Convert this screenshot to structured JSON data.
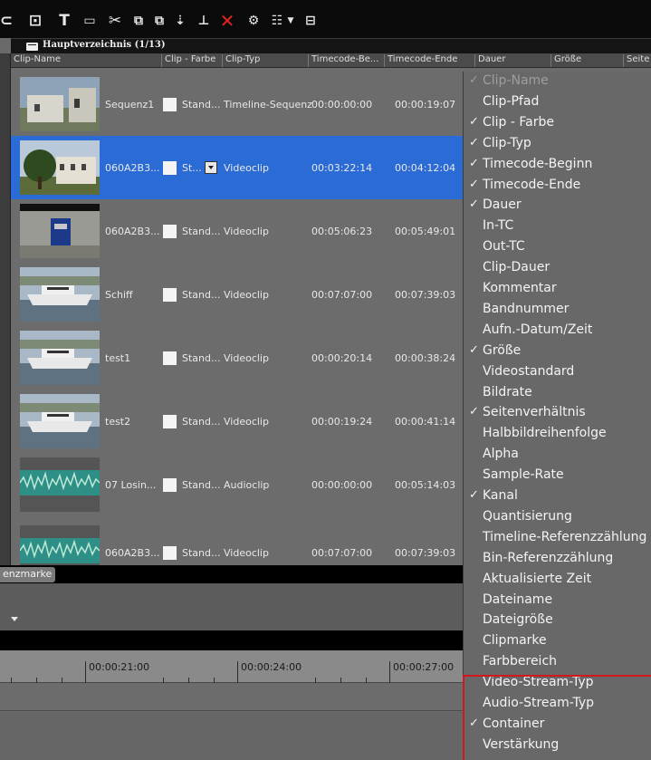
{
  "toolbar": {
    "icons": [
      "folder-in-icon",
      "title-icon",
      "monitor-icon",
      "cut-icon",
      "copy-icon",
      "paste-icon",
      "insert-icon",
      "overwrite-icon",
      "delete-icon",
      "properties-icon",
      "list-view-icon",
      "dropdown-icon",
      "storyboard-icon"
    ],
    "title_glyph": "T"
  },
  "bin": {
    "title": "Hauptverzeichnis (1/13)"
  },
  "columns": [
    "Clip-Name",
    "Clip - Farbe",
    "Clip-Typ",
    "Timecode-Be...",
    "Timecode-Ende",
    "Dauer",
    "Größe",
    "Seite"
  ],
  "clips": [
    {
      "name": "Sequenz1",
      "color": "Stand...",
      "type": "Timeline-Sequenz",
      "tc_begin": "00:00:00:00",
      "tc_end": "00:00:19:07",
      "thumb": "building"
    },
    {
      "name": "060A2B3...",
      "color": "St...",
      "type": "Videoclip",
      "tc_begin": "00:03:22:14",
      "tc_end": "00:04:12:04",
      "thumb": "tree-building",
      "selected": true
    },
    {
      "name": "060A2B3...",
      "color": "Stand...",
      "type": "Videoclip",
      "tc_begin": "00:05:06:23",
      "tc_end": "00:05:49:01",
      "thumb": "mailbox"
    },
    {
      "name": "Schiff",
      "color": "Stand...",
      "type": "Videoclip",
      "tc_begin": "00:07:07:00",
      "tc_end": "00:07:39:03",
      "thumb": "ship"
    },
    {
      "name": "test1",
      "color": "Stand...",
      "type": "Videoclip",
      "tc_begin": "00:00:20:14",
      "tc_end": "00:00:38:24",
      "thumb": "ship"
    },
    {
      "name": "test2",
      "color": "Stand...",
      "type": "Videoclip",
      "tc_begin": "00:00:19:24",
      "tc_end": "00:00:41:14",
      "thumb": "ship"
    },
    {
      "name": "07 Losin...",
      "color": "Stand...",
      "type": "Audioclip",
      "tc_begin": "00:00:00:00",
      "tc_end": "00:05:14:03",
      "thumb": "audio"
    },
    {
      "name": "060A2B3...",
      "color": "Stand...",
      "type": "Videoclip",
      "tc_begin": "00:07:07:00",
      "tc_end": "00:07:39:03",
      "thumb": "audio"
    }
  ],
  "bottom": {
    "tab_label": "enzmarke",
    "ruler_labels": [
      "00:00:21:00",
      "00:00:24:00",
      "00:00:27:00"
    ]
  },
  "menu": {
    "check_glyph": "✓",
    "items": [
      {
        "label": "Clip-Name",
        "checked": true,
        "disabled": true
      },
      {
        "label": "Clip-Pfad",
        "checked": false
      },
      {
        "label": "Clip - Farbe",
        "checked": true
      },
      {
        "label": "Clip-Typ",
        "checked": true
      },
      {
        "label": "Timecode-Beginn",
        "checked": true
      },
      {
        "label": "Timecode-Ende",
        "checked": true
      },
      {
        "label": "Dauer",
        "checked": true
      },
      {
        "label": "In-TC",
        "checked": false
      },
      {
        "label": "Out-TC",
        "checked": false
      },
      {
        "label": "Clip-Dauer",
        "checked": false
      },
      {
        "label": "Kommentar",
        "checked": false
      },
      {
        "label": "Bandnummer",
        "checked": false
      },
      {
        "label": "Aufn.-Datum/Zeit",
        "checked": false
      },
      {
        "label": "Größe",
        "checked": true
      },
      {
        "label": "Videostandard",
        "checked": false
      },
      {
        "label": "Bildrate",
        "checked": false
      },
      {
        "label": "Seitenverhältnis",
        "checked": true
      },
      {
        "label": "Halbbildreihenfolge",
        "checked": false
      },
      {
        "label": "Alpha",
        "checked": false
      },
      {
        "label": "Sample-Rate",
        "checked": false
      },
      {
        "label": "Kanal",
        "checked": true
      },
      {
        "label": "Quantisierung",
        "checked": false
      },
      {
        "label": "Timeline-Referenzzählung",
        "checked": false
      },
      {
        "label": "Bin-Referenzzählung",
        "checked": false
      },
      {
        "label": "Aktualisierte Zeit",
        "checked": false
      },
      {
        "label": "Dateiname",
        "checked": false
      },
      {
        "label": "Dateigröße",
        "checked": false
      },
      {
        "label": "Clipmarke",
        "checked": false
      },
      {
        "label": "Farbbereich",
        "checked": false
      },
      {
        "label": "Video-Stream-Typ",
        "checked": false
      },
      {
        "label": "Audio-Stream-Typ",
        "checked": false
      },
      {
        "label": "Container",
        "checked": true
      },
      {
        "label": "Verstärkung",
        "checked": false
      }
    ],
    "highlight_color": "#d2171f"
  },
  "colors": {
    "selection": "#2a6bd6",
    "delete": "#e2241a"
  }
}
